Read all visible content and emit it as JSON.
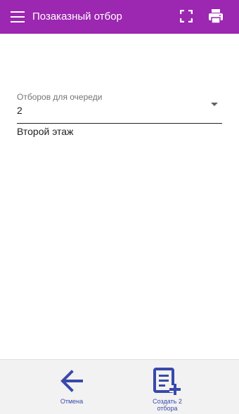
{
  "app_bar": {
    "title": "Позаказный отбор",
    "menu_icon": "hamburger-menu-icon",
    "fullscreen_icon": "fullscreen-icon",
    "print_icon": "printer-icon"
  },
  "form": {
    "queue_select": {
      "label": "Отборов для очереди",
      "value": "2",
      "arrow_icon": "dropdown-arrow-icon"
    },
    "helper_text": "Второй этаж"
  },
  "bottom_bar": {
    "cancel": {
      "label": "Отмена",
      "icon": "arrow-left-icon"
    },
    "create": {
      "label_line1": "Создать 2",
      "label_line2": "отбора",
      "icon": "playlist-add-icon"
    }
  },
  "colors": {
    "app_bar": "#9c27b0",
    "accent": "#3949ab",
    "bottom_bar": "#f2f2f2"
  }
}
